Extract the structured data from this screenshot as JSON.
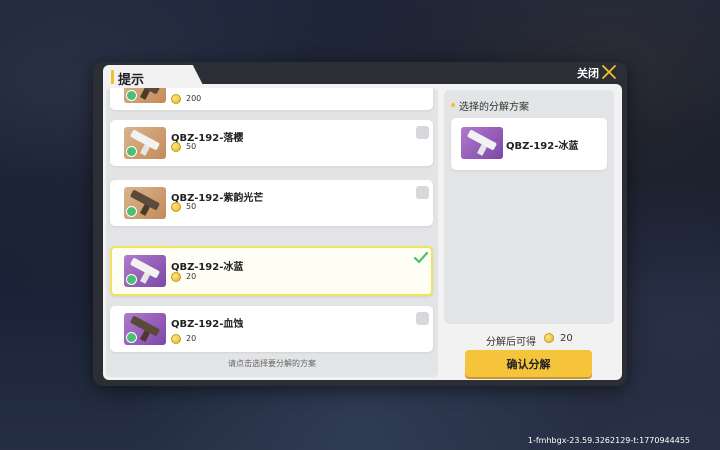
{
  "dialog": {
    "title": "提示",
    "close_label": "关闭"
  },
  "list": {
    "items": [
      {
        "name": "",
        "value": "200",
        "theme": "orange",
        "selected": false
      },
      {
        "name": "QBZ-192-落樱",
        "value": "50",
        "theme": "orange",
        "selected": false
      },
      {
        "name": "QBZ-192-紫韵光芒",
        "value": "50",
        "theme": "orange",
        "selected": false
      },
      {
        "name": "QBZ-192-冰蓝",
        "value": "20",
        "theme": "purple",
        "selected": true
      },
      {
        "name": "QBZ-192-血蚀",
        "value": "20",
        "theme": "purple",
        "selected": false
      }
    ],
    "hint": "请点击选择要分解的方案"
  },
  "plan": {
    "title": "选择的分解方案",
    "selected_name": "QBZ-192-冰蓝"
  },
  "yield": {
    "label": "分解后可得",
    "value": "20"
  },
  "confirm_label": "确认分解",
  "session_id": "1-fmhbgx-23.59.3262129-t:1770944455",
  "colors": {
    "accent_yellow": "#f5c43b",
    "selected_border": "#f0e45c",
    "check_green": "#4bbf73"
  }
}
